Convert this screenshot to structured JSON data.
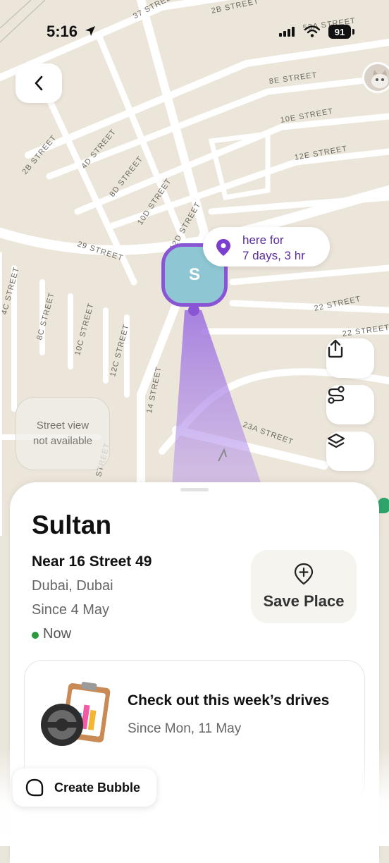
{
  "status_bar": {
    "time": "5:16",
    "battery": "91"
  },
  "map": {
    "street_labels": [
      "37 STREET",
      "2B STREET",
      "53A STREET",
      "8E STREET",
      "10E STREET",
      "12E STREET",
      "2B STREET",
      "4D STREET",
      "8D STREET",
      "10D STREET",
      "12D STREET",
      "29 STREET",
      "4C STREET",
      "8C STREET",
      "10C STREET",
      "12C STREET",
      "14 STREET",
      "22 STREET",
      "22 STREET",
      "23A STREET",
      "STREET"
    ],
    "duration_pill": {
      "line1": "here for",
      "line2": "7 days, 3 hr"
    },
    "marker_letter": "S",
    "street_view_line1": "Street view",
    "street_view_line2": "not available"
  },
  "place": {
    "name": "Sultan",
    "near": "Near 16 Street 49",
    "city": "Dubai, Dubai",
    "since": "Since 4 May",
    "status": "Now",
    "save_label": "Save Place"
  },
  "drives_card": {
    "title": "Check out this week’s drives",
    "subtitle": "Since Mon, 11 May"
  },
  "create_bubble_label": "Create Bubble",
  "colors": {
    "accent": "#8a55d4",
    "marker_fill": "#8ec7d3",
    "online": "#2a9a3c"
  }
}
